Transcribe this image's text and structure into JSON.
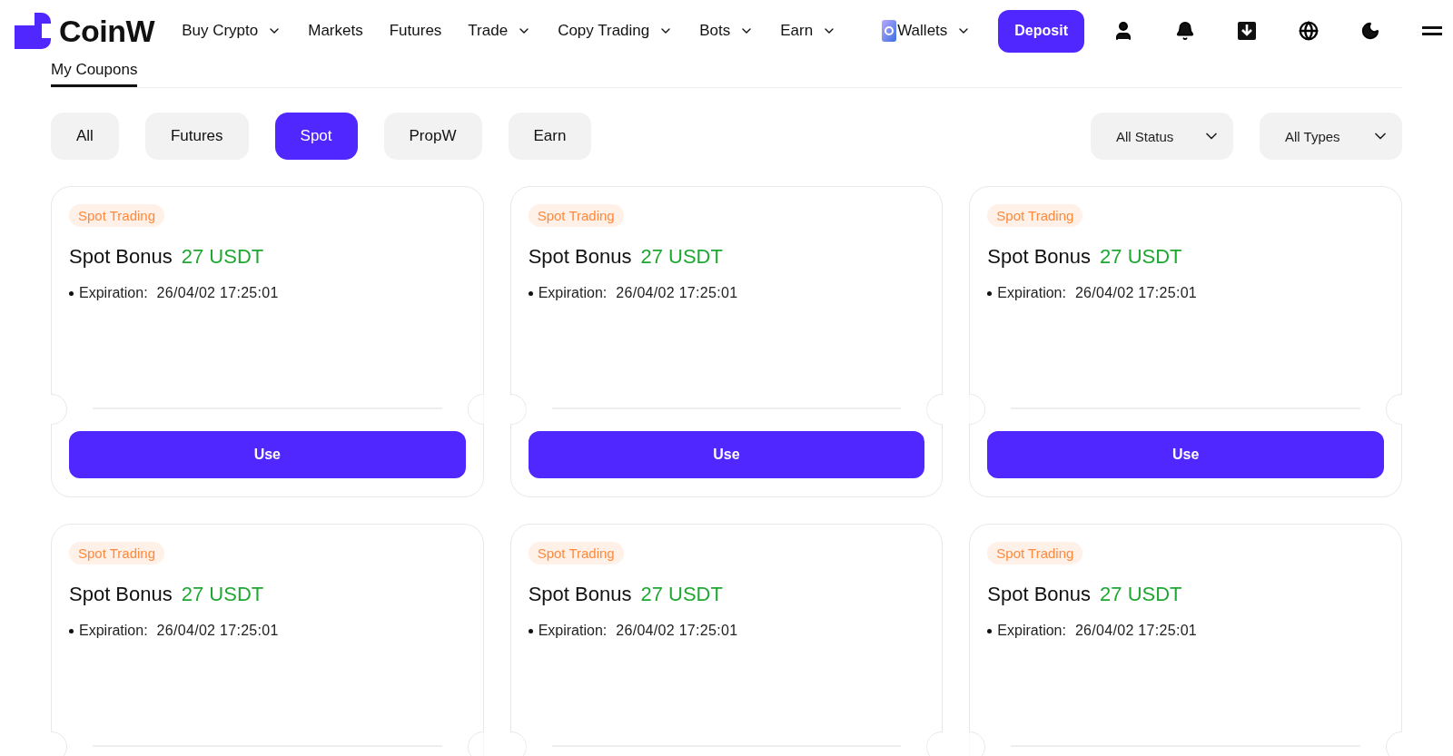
{
  "header": {
    "logo": "CoinW",
    "nav": [
      {
        "label": "Buy Crypto",
        "has_menu": true
      },
      {
        "label": "Markets",
        "has_menu": false
      },
      {
        "label": "Futures",
        "has_menu": false
      },
      {
        "label": "Trade",
        "has_menu": true
      },
      {
        "label": "Copy Trading",
        "has_menu": true
      },
      {
        "label": "Bots",
        "has_menu": true
      },
      {
        "label": "Earn",
        "has_menu": true
      }
    ],
    "wallets": {
      "label": "Wallets",
      "has_menu": true
    },
    "deposit": "Deposit"
  },
  "page_tabs": [
    {
      "label": "My Coupons",
      "selected": true
    }
  ],
  "filters": [
    {
      "label": "All",
      "selected": false
    },
    {
      "label": "Futures",
      "selected": false
    },
    {
      "label": "Spot",
      "selected": true
    },
    {
      "label": "PropW",
      "selected": false
    },
    {
      "label": "Earn",
      "selected": false
    }
  ],
  "dropdowns": [
    "All Status",
    "All Types"
  ],
  "coupons": [
    {
      "tag": "Spot Trading",
      "title": "Spot Bonus",
      "amount": "27 USDT",
      "expiration_label": "Expiration:",
      "expiration": "26/04/02 17:25:01",
      "button": "Use"
    },
    {
      "tag": "Spot Trading",
      "title": "Spot Bonus",
      "amount": "27 USDT",
      "expiration_label": "Expiration:",
      "expiration": "26/04/02 17:25:01",
      "button": "Use"
    },
    {
      "tag": "Spot Trading",
      "title": "Spot Bonus",
      "amount": "27 USDT",
      "expiration_label": "Expiration:",
      "expiration": "26/04/02 17:25:01",
      "button": "Use"
    },
    {
      "tag": "Spot Trading",
      "title": "Spot Bonus",
      "amount": "27 USDT",
      "expiration_label": "Expiration:",
      "expiration": "26/04/02 17:25:01"
    },
    {
      "tag": "Spot Trading",
      "title": "Spot Bonus",
      "amount": "27 USDT",
      "expiration_label": "Expiration:",
      "expiration": "26/04/02 17:25:01"
    },
    {
      "tag": "Spot Trading",
      "title": "Spot Bonus",
      "amount": "27 USDT",
      "expiration_label": "Expiration:",
      "expiration": "26/04/02 17:25:01"
    }
  ]
}
